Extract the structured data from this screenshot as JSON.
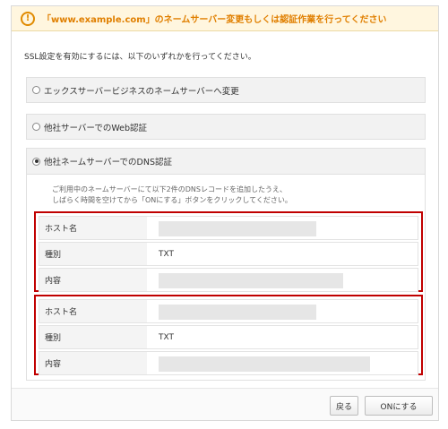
{
  "alert": {
    "icon": "exclamation-icon",
    "icon_glyph": "!",
    "message": "「www.example.com」のネームサーバー変更もしくは認証作業を行ってください"
  },
  "intro": "SSL設定を有効にするには、以下のいずれかを行ってください。",
  "options": [
    {
      "label": "エックスサーバービジネスのネームサーバーへ変更",
      "selected": false
    },
    {
      "label": "他社サーバーでのWeb認証",
      "selected": false
    },
    {
      "label": "他社ネームサーバーでのDNS認証",
      "selected": true
    }
  ],
  "dns": {
    "description_line1": "ご利用中のネームサーバーにて以下2件のDNSレコードを追加したうえ、",
    "description_line2": "しばらく時間を空けてから「ONにする」ボタンをクリックしてください。",
    "records": [
      {
        "host_label": "ホスト名",
        "type_label": "種別",
        "type_value": "TXT",
        "content_label": "内容"
      },
      {
        "host_label": "ホスト名",
        "type_label": "種別",
        "type_value": "TXT",
        "content_label": "内容"
      }
    ]
  },
  "buttons": {
    "back": "戻る",
    "on": "ONにする"
  },
  "colors": {
    "alert_text": "#e07f00",
    "highlight_border": "#c00000"
  }
}
